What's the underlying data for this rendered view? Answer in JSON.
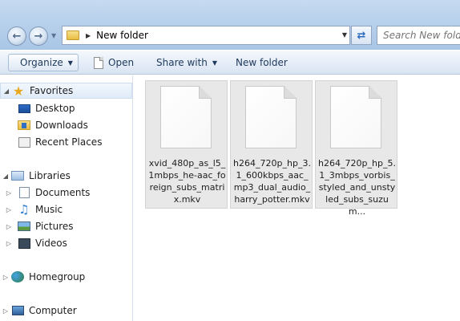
{
  "address_bar": {
    "path": "New folder",
    "search_placeholder": "Search New folder"
  },
  "toolbar": {
    "organize": "Organize",
    "open": "Open",
    "share_with": "Share with",
    "new_folder": "New folder"
  },
  "nav_pane": {
    "favorites": "Favorites",
    "desktop": "Desktop",
    "downloads": "Downloads",
    "recent_places": "Recent Places",
    "libraries": "Libraries",
    "documents": "Documents",
    "music": "Music",
    "pictures": "Pictures",
    "videos": "Videos",
    "homegroup": "Homegroup",
    "computer": "Computer"
  },
  "files": [
    {
      "name": "xvid_480p_as_l5_1mbps_he-aac_foreign_subs_matrix.mkv",
      "icon": "generic-file-icon"
    },
    {
      "name": "h264_720p_hp_3.1_600kbps_aac_mp3_dual_audio_harry_potter.mkv",
      "icon": "generic-file-icon"
    },
    {
      "name": "h264_720p_hp_5.1_3mbps_vorbis_styled_and_unstyled_subs_suzum...",
      "icon": "generic-file-icon"
    }
  ],
  "colors": {
    "titlebar": "#b9d1ec",
    "commandbar": "#e6eef8",
    "selected_file_bg": "#e8e8e8",
    "link_text": "#1e395b"
  }
}
